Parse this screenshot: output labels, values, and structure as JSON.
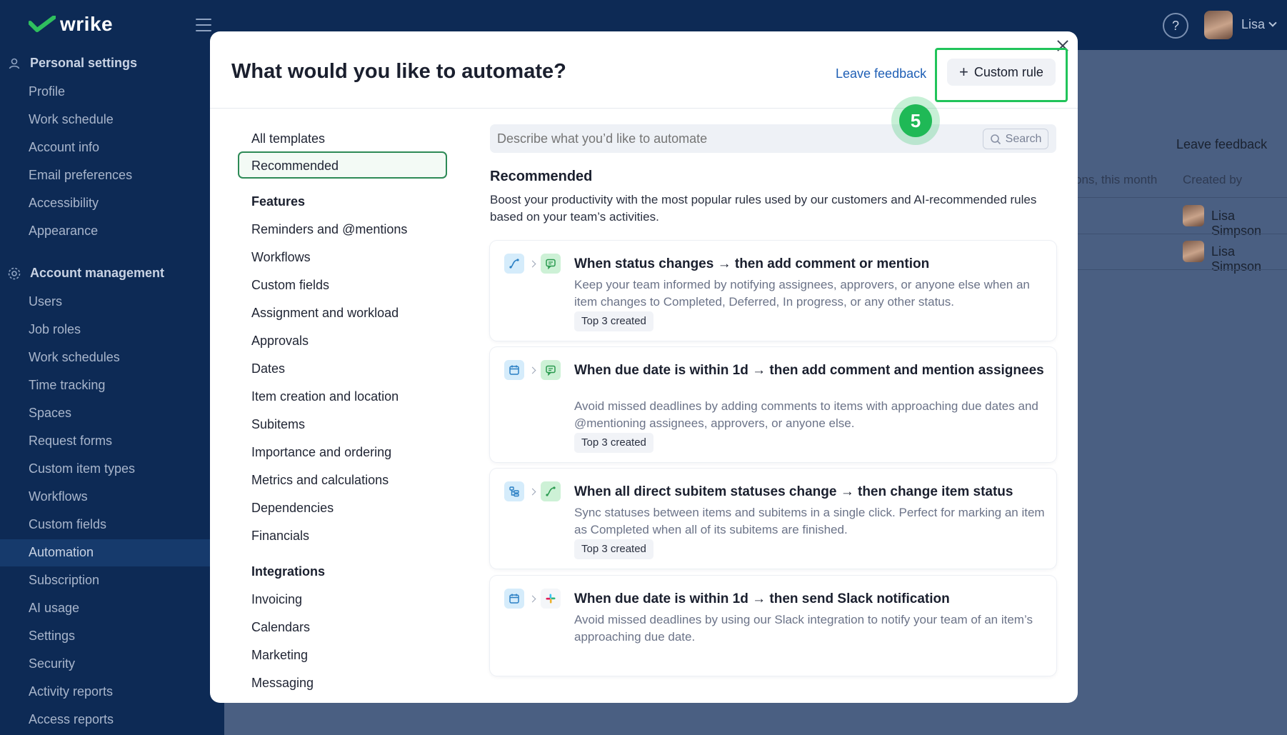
{
  "app": {
    "brand": "wrike",
    "user_name": "Lisa",
    "help_symbol": "?"
  },
  "sidebar": {
    "personal_section": "Personal settings",
    "personal_items": [
      "Profile",
      "Work schedule",
      "Account info",
      "Email preferences",
      "Accessibility",
      "Appearance"
    ],
    "account_section": "Account management",
    "account_items": [
      "Users",
      "Job roles",
      "Work schedules",
      "Time tracking",
      "Spaces",
      "Request forms",
      "Custom item types",
      "Workflows",
      "Custom fields",
      "Automation",
      "Subscription",
      "AI usage",
      "Settings",
      "Security",
      "Activity reports",
      "Access reports"
    ],
    "active_item": "Automation"
  },
  "background": {
    "leave_feedback": "Leave feedback",
    "col_actions": "ons, this month",
    "col_created_by": "Created by",
    "rows": [
      {
        "created_by": "Lisa Simpson"
      },
      {
        "created_by": "Lisa Simpson"
      }
    ]
  },
  "modal": {
    "title": "What would you like to automate?",
    "leave_feedback": "Leave feedback",
    "custom_rule_label": "Custom rule",
    "custom_rule_symbol": "+",
    "categories_top": [
      "All templates",
      "Recommended"
    ],
    "selected_category": "Recommended",
    "features_heading": "Features",
    "features": [
      "Reminders and @mentions",
      "Workflows",
      "Custom fields",
      "Assignment and workload",
      "Approvals",
      "Dates",
      "Item creation and location",
      "Subitems",
      "Importance and ordering",
      "Metrics and calculations",
      "Dependencies",
      "Financials"
    ],
    "integrations_heading": "Integrations",
    "integrations": [
      "Invoicing",
      "Calendars",
      "Marketing",
      "Messaging"
    ],
    "search_placeholder": "Describe what you’d like to automate",
    "search_button": "Search",
    "section_title": "Recommended",
    "section_desc": "Boost your productivity with the most popular rules used by our customers and AI-recommended rules based on your team’s activities.",
    "cards": [
      {
        "title": "When status changes → then add comment or mention",
        "desc": "Keep your team informed by notifying assignees, approvers, or anyone else when an item changes to Completed, Deferred, In progress, or any other status.",
        "badge": "Top 3 created",
        "icons": [
          "status-change-icon",
          "comment-icon"
        ]
      },
      {
        "title": "When due date is within 1d → then add comment and mention assignees",
        "desc": "Avoid missed deadlines by adding comments to items with approaching due dates and @mentioning assignees, approvers, or anyone else.",
        "badge": "Top 3 created",
        "icons": [
          "calendar-icon",
          "comment-icon"
        ]
      },
      {
        "title": "When all direct subitem statuses change → then change item status",
        "desc": "Sync statuses between items and subitems in a single click. Perfect for marking an item as Completed when all of its subitems are finished.",
        "badge": "Top 3 created",
        "icons": [
          "subitems-icon",
          "status-change-icon"
        ]
      },
      {
        "title": "When due date is within 1d → then send Slack notification",
        "desc": "Avoid missed deadlines by using our Slack integration to notify your team of an item’s approaching due date.",
        "icons": [
          "calendar-icon",
          "slack-icon"
        ]
      }
    ]
  },
  "annotation": {
    "step_number": "5",
    "color": "#21c45a"
  }
}
